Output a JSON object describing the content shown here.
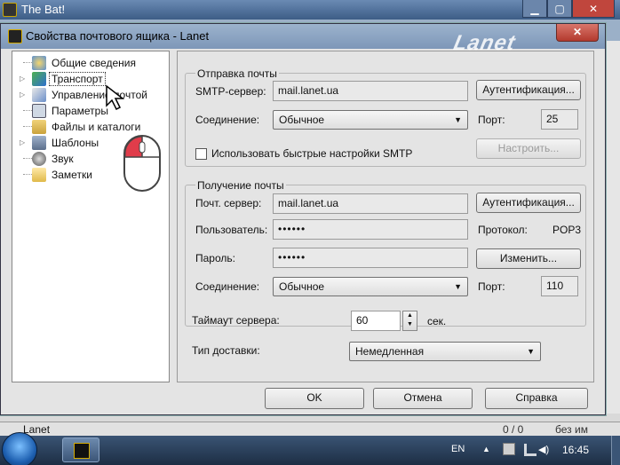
{
  "app": {
    "title": "The Bat!",
    "status_account": "Lanet",
    "status_count": "0 / 0",
    "status_size": "без им"
  },
  "dialog": {
    "title": "Свойства почтового ящика - Lanet",
    "watermark": "Lanet"
  },
  "tree": {
    "items": [
      {
        "label": "Общие сведения",
        "icon": "general-info-icon"
      },
      {
        "label": "Транспорт",
        "icon": "transport-icon",
        "selected": true
      },
      {
        "label": "Управление почтой",
        "icon": "mail-management-icon"
      },
      {
        "label": "Параметры",
        "icon": "parameters-icon"
      },
      {
        "label": "Файлы и каталоги",
        "icon": "files-folders-icon"
      },
      {
        "label": "Шаблоны",
        "icon": "templates-icon"
      },
      {
        "label": "Звук",
        "icon": "sound-icon"
      },
      {
        "label": "Заметки",
        "icon": "notes-icon"
      }
    ]
  },
  "smtp": {
    "group_title": "Отправка почты",
    "server_label": "SMTP-сервер:",
    "server_value": "mail.lanet.ua",
    "auth_button": "Аутентификация...",
    "connection_label": "Соединение:",
    "connection_value": "Обычное",
    "port_label": "Порт:",
    "port_value": "25",
    "configure_button": "Настроить...",
    "quick_settings_label": "Использовать быстрые настройки SMTP",
    "quick_settings_checked": false
  },
  "receive": {
    "group_title": "Получение почты",
    "server_label": "Почт. сервер:",
    "server_value": "mail.lanet.ua",
    "auth_button": "Аутентификация...",
    "user_label": "Пользователь:",
    "user_value": "••••••",
    "protocol_label": "Протокол:",
    "protocol_value": "POP3",
    "password_label": "Пароль:",
    "password_value": "••••••",
    "change_button": "Изменить...",
    "connection_label": "Соединение:",
    "connection_value": "Обычное",
    "port_label": "Порт:",
    "port_value": "110"
  },
  "timeout": {
    "label": "Таймаут сервера:",
    "value": "60",
    "unit": "сек."
  },
  "delivery": {
    "label": "Тип доставки:",
    "value": "Немедленная"
  },
  "buttons": {
    "ok": "OK",
    "cancel": "Отмена",
    "help": "Справка"
  },
  "taskbar": {
    "lang": "EN",
    "time": "16:45"
  }
}
